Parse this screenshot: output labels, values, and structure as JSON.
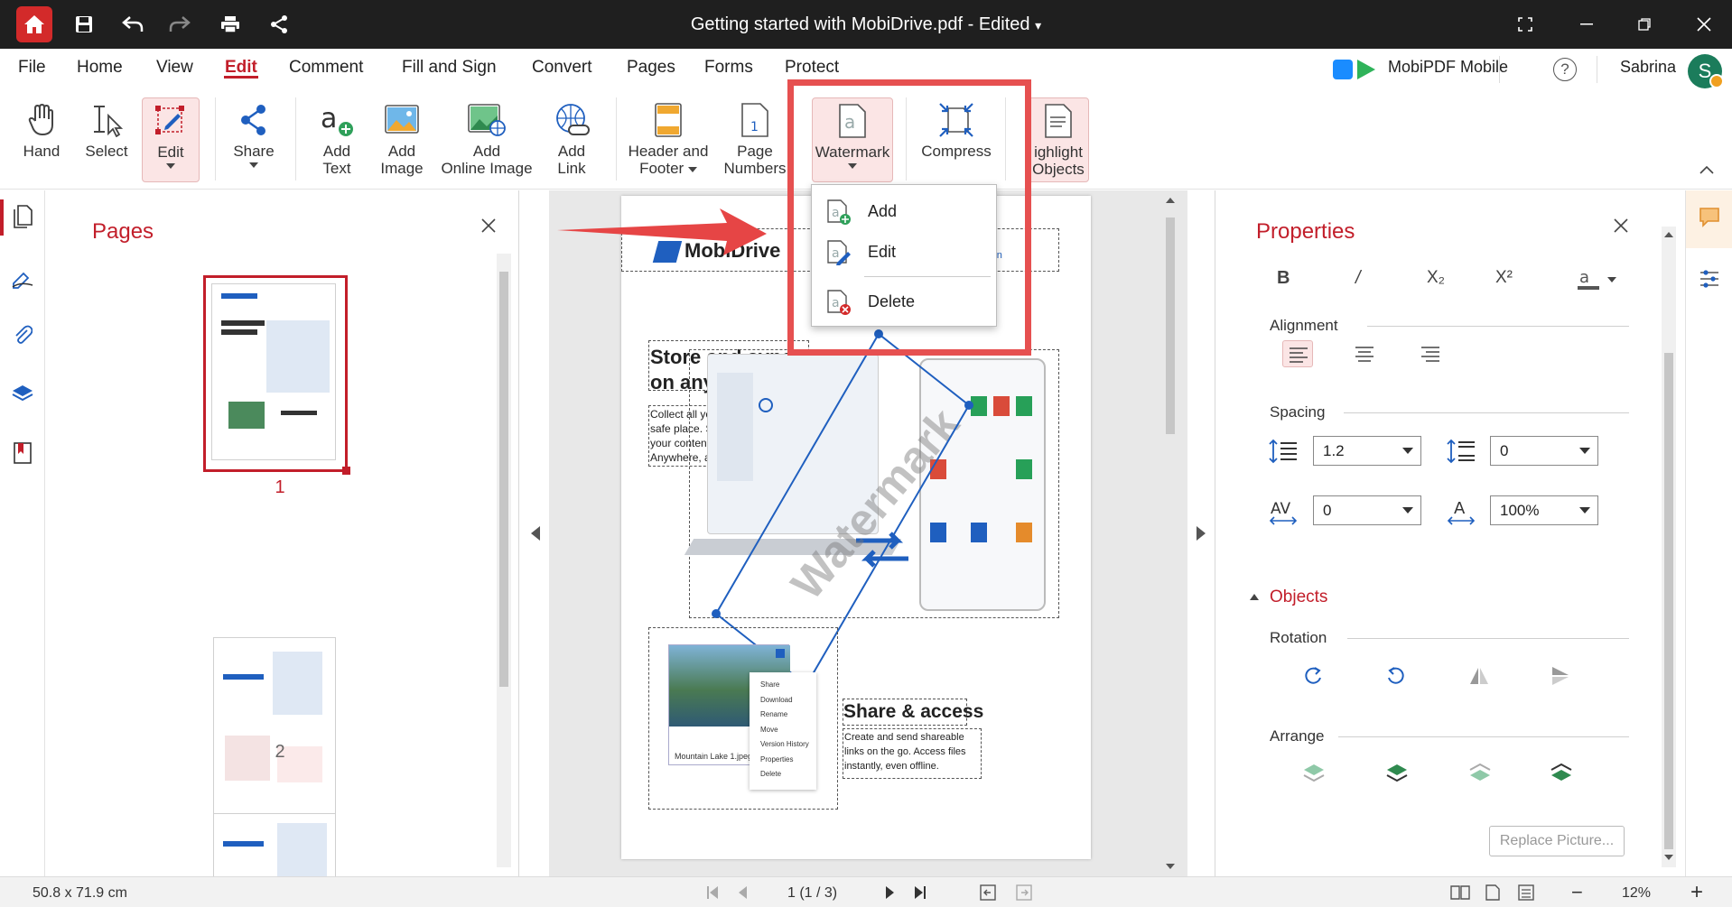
{
  "titlebar": {
    "title": "Getting started with MobiDrive.pdf - Edited",
    "title_arrow": "▾"
  },
  "menu": {
    "file": "File",
    "home": "Home",
    "view": "View",
    "edit": "Edit",
    "comment": "Comment",
    "fill_sign": "Fill and Sign",
    "convert": "Convert",
    "pages": "Pages",
    "forms": "Forms",
    "protect": "Protect"
  },
  "header_right": {
    "mobile": "MobiPDF Mobile",
    "help": "?",
    "user": "Sabrina",
    "avatar_letter": "S"
  },
  "ribbon": {
    "hand": "Hand",
    "select": "Select",
    "edit": "Edit",
    "share": "Share",
    "add_text_1": "Add",
    "add_text_2": "Text",
    "add_image_1": "Add",
    "add_image_2": "Image",
    "add_online_1": "Add",
    "add_online_2": "Online Image",
    "add_link_1": "Add",
    "add_link_2": "Link",
    "header_1": "Header and",
    "header_2": "Footer",
    "pnum_1": "Page",
    "pnum_2": "Numbers",
    "watermark": "Watermark",
    "compress": "Compress",
    "highlight_1": "ighlight",
    "highlight_2": "Objects"
  },
  "watermark_menu": {
    "add": "Add",
    "edit": "Edit",
    "delete": "Delete"
  },
  "pages_panel": {
    "title": "Pages",
    "page1": "1",
    "page2": "2"
  },
  "document": {
    "logo": "MobiDrive",
    "heading1_a": "Store and sync",
    "heading1_b": "on any device",
    "para1_a": "Collect all your files in one",
    "para1_b": "safe place. Sync and access",
    "para1_c": "your content on all platforms.",
    "para1_d": "Anywhere, anytime.",
    "watermark_text": "Watermark",
    "heading2": "Share & access",
    "para2_a": "Create and send shareable",
    "para2_b": "links on the go. Access files",
    "para2_c": "instantly, even offline.",
    "photo_caption": "Mountain Lake 1.jpeg",
    "ctx_menu": [
      "Share",
      "Download",
      "Rename",
      "Move",
      "Version History",
      "Properties",
      "Delete"
    ],
    "url_partial": "e.con"
  },
  "properties": {
    "title": "Properties",
    "bold": "B",
    "italic": "/",
    "subscript": "X₂",
    "superscript": "X²",
    "alignment": "Alignment",
    "spacing": "Spacing",
    "line_spacing": "1.2",
    "para_spacing": "0",
    "char_spacing": "0",
    "scale": "100%",
    "objects": "Objects",
    "rotation": "Rotation",
    "arrange": "Arrange",
    "replace_picture": "Replace Picture..."
  },
  "statusbar": {
    "size": "50.8 x 71.9 cm",
    "page": "1 (1 / 3)",
    "zoom": "12%",
    "minus": "−",
    "plus": "+"
  },
  "colors": {
    "accent": "#c21e2a",
    "titlebar": "#1f1f1f",
    "callout": "#e65050",
    "selection_blue": "#1f5fbf"
  }
}
